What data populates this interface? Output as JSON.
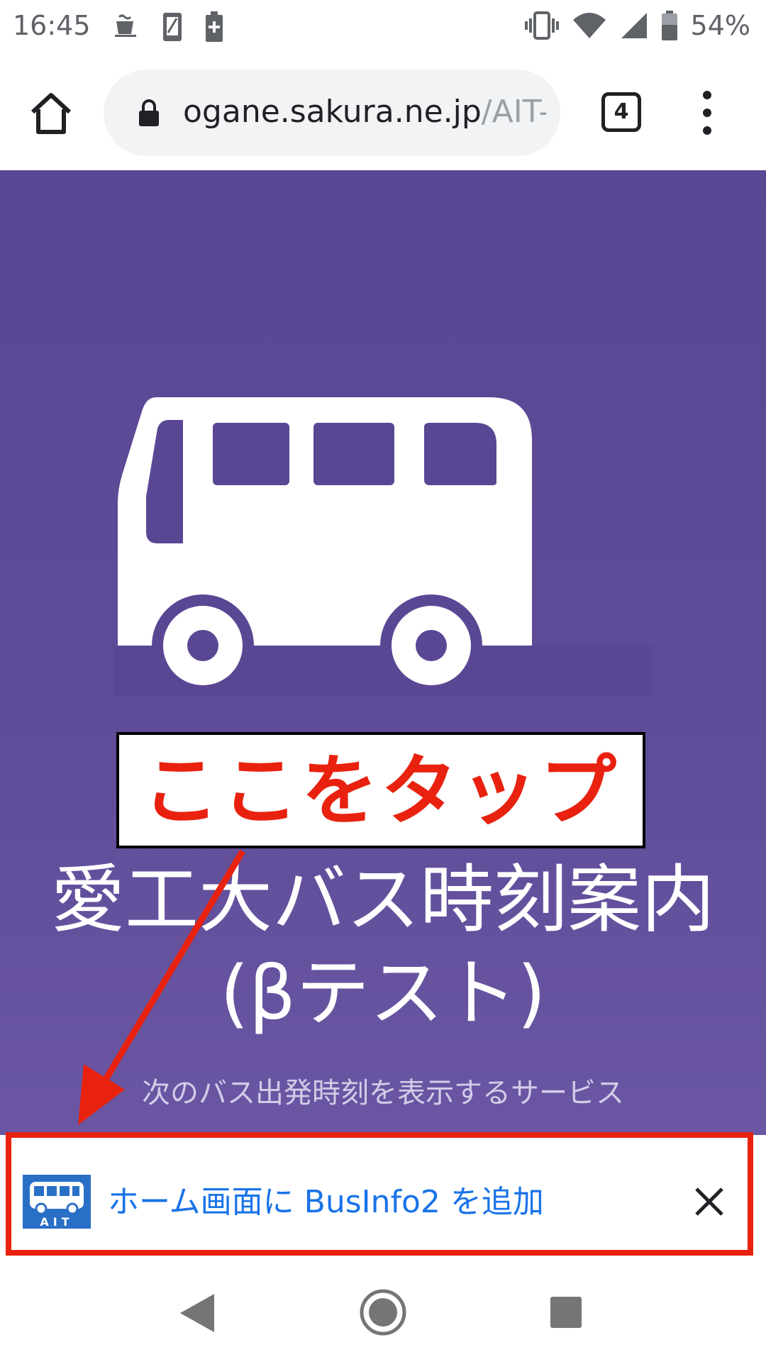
{
  "status_bar": {
    "time": "16:45",
    "battery_percent": "54%",
    "left_icons": [
      "cup-icon",
      "sd-card-icon",
      "battery-saver-icon"
    ],
    "right_icons": [
      "vibrate-icon",
      "wifi-icon",
      "signal-icon",
      "battery-icon"
    ]
  },
  "browser": {
    "url_host": "ogane.sakura.ne.jp",
    "url_path": "/AIT-",
    "tab_count": "4"
  },
  "page": {
    "annotation_label": "ここをタップ",
    "title_line1": "愛工大バス時刻案内",
    "title_line2": "(βテスト)",
    "subtitle": "次のバス出発時刻を表示するサービス",
    "background_color": "#5a4794"
  },
  "install_banner": {
    "label": "ホーム画面に BusInfo2 を追加",
    "app_icon_text": "AIT",
    "highlight_color": "#e8220f",
    "link_color": "#1a73e8"
  },
  "nav_bar": {
    "icons": [
      "back-icon",
      "home-icon",
      "recents-icon"
    ]
  }
}
